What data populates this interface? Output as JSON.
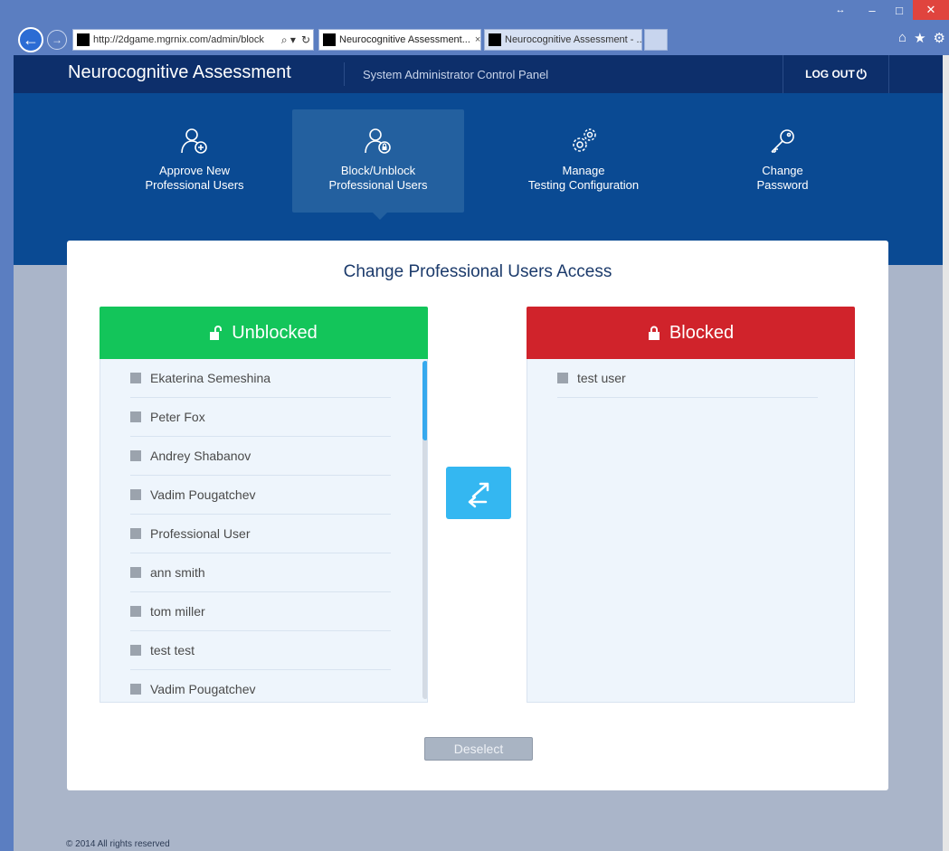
{
  "browser": {
    "address": "http://2dgame.mgrnix.com/admin/block",
    "address_domain_bold": "mgrnix.com",
    "tabs": [
      {
        "label": "Neurocognitive Assessment...",
        "active": true
      },
      {
        "label": "Neurocognitive Assessment - ...",
        "active": false
      }
    ],
    "icons": [
      "back-icon",
      "forward-icon",
      "search-icon",
      "refresh-icon",
      "home-icon",
      "favorites-star-icon",
      "settings-gear-icon"
    ],
    "window_controls": [
      "resize",
      "minimize",
      "maximize",
      "close"
    ]
  },
  "header": {
    "brand": "Neurocognitive Assessment",
    "panel_title": "System Administrator Control Panel",
    "logout_label": "LOG OUT"
  },
  "nav": {
    "items": [
      {
        "line1": "Approve New",
        "line2": "Professional Users",
        "icon": "user-add-icon",
        "selected": false
      },
      {
        "line1": "Block/Unblock",
        "line2": "Professional Users",
        "icon": "user-lock-icon",
        "selected": true
      },
      {
        "line1": "Manage",
        "line2": "Testing Configuration",
        "icon": "gears-icon",
        "selected": false
      },
      {
        "line1": "Change",
        "line2": "Password",
        "icon": "key-icon",
        "selected": false
      }
    ]
  },
  "main": {
    "title": "Change Professional Users Access",
    "unblocked": {
      "title": "Unblocked",
      "users": [
        "Ekaterina Semeshina",
        "Peter Fox",
        "Andrey Shabanov",
        "Vadim Pougatchev",
        "Professional User",
        "ann smith",
        "tom miller",
        "test test",
        "Vadim Pougatchev"
      ]
    },
    "blocked": {
      "title": "Blocked",
      "users": [
        "test user"
      ]
    },
    "deselect_label": "Deselect"
  },
  "footer": {
    "text": "© 2014 All rights reserved"
  },
  "colors": {
    "unblocked": "#13c55a",
    "blocked": "#d0232b",
    "transfer_button": "#34b7f1",
    "header": "#0d2f6b",
    "nav_band": "#0a4a93"
  }
}
